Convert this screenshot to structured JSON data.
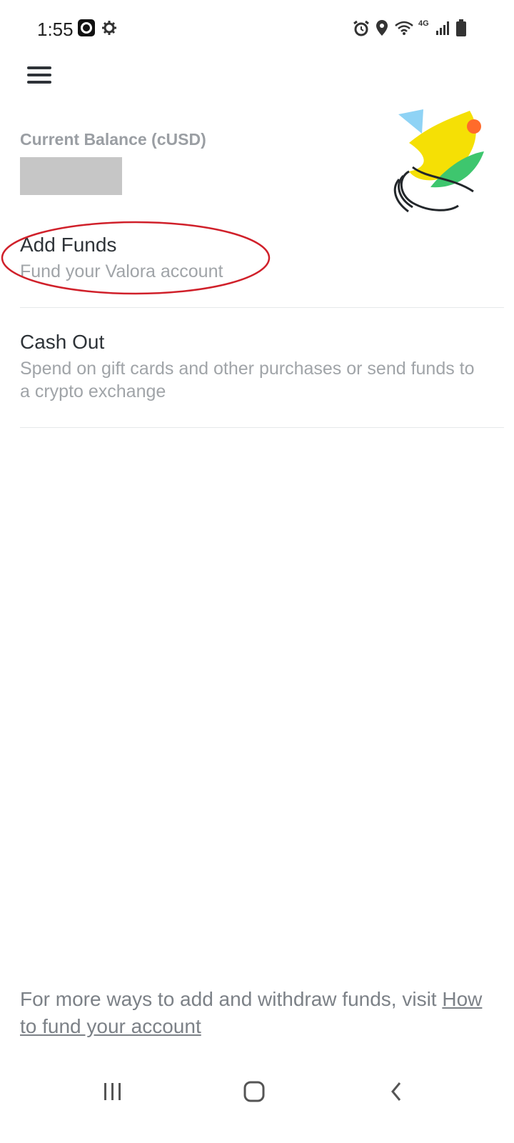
{
  "status_bar": {
    "time": "1:55",
    "network": "4G",
    "icons": [
      "app-notification-icon",
      "settings-gear-icon",
      "alarm-icon",
      "location-icon",
      "wifi-icon",
      "signal-icon",
      "battery-icon"
    ]
  },
  "header": {
    "menu_icon": "hamburger-menu-icon"
  },
  "balance": {
    "label": "Current Balance (cUSD)"
  },
  "options": [
    {
      "title": "Add Funds",
      "subtitle": "Fund your Valora account"
    },
    {
      "title": "Cash Out",
      "subtitle": "Spend on gift cards and other purchases or send funds to a crypto exchange"
    }
  ],
  "annotation_color": "#d0202a",
  "footer": {
    "text": "For more ways to add and withdraw funds, visit",
    "link": "How to fund your account"
  },
  "nav_bar": {
    "icons": [
      "recent-apps-icon",
      "home-icon",
      "back-icon"
    ]
  }
}
